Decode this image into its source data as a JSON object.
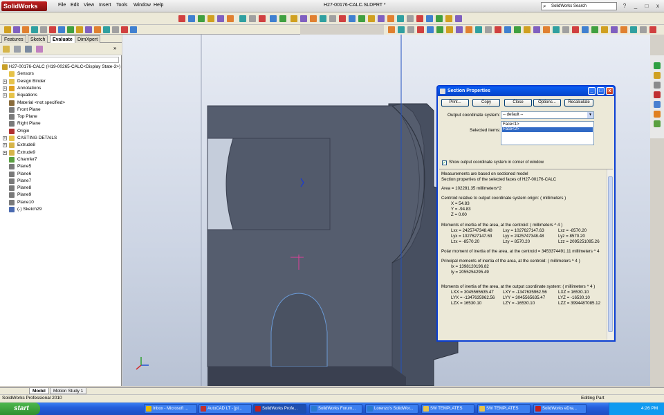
{
  "app": {
    "logo": "SolidWorks",
    "menu": [
      "File",
      "Edit",
      "View",
      "Insert",
      "Tools",
      "Window",
      "Help"
    ],
    "doc_title": "H27-00176-CALC.SLDPRT *",
    "search_placeholder": "SolidWorks Search",
    "help_icon": "?",
    "window_buttons": [
      "_",
      "□",
      "x"
    ]
  },
  "featuremanager": {
    "tabs": [
      "Features",
      "Sketch",
      "Evaluate",
      "DimXpert"
    ],
    "active_tab": "Evaluate",
    "tree": [
      {
        "label": "H27-00176-CALC (H19-00265-CALC<Display State-3>)",
        "root": true,
        "color": "#c8a028"
      },
      {
        "label": "Sensors",
        "color": "#e6c34a"
      },
      {
        "label": "Design Binder",
        "expand": "+",
        "color": "#e6c34a"
      },
      {
        "label": "Annotations",
        "expand": "+",
        "color": "#e0a020"
      },
      {
        "label": "Equations",
        "expand": "+",
        "color": "#e6c34a"
      },
      {
        "label": "Material <not specified>",
        "color": "#8a6c3c"
      },
      {
        "label": "Front Plane",
        "color": "#7a7a7a"
      },
      {
        "label": "Top Plane",
        "color": "#7a7a7a"
      },
      {
        "label": "Right Plane",
        "color": "#7a7a7a"
      },
      {
        "label": "Origin",
        "color": "#b03030"
      },
      {
        "label": "CASTING DETAILS",
        "expand": "+",
        "color": "#e6c34a"
      },
      {
        "label": "Extrude8",
        "expand": "+",
        "color": "#d6b54a"
      },
      {
        "label": "Extrude9",
        "expand": "+",
        "color": "#d6b54a"
      },
      {
        "label": "Chamfer7",
        "color": "#5aa040"
      },
      {
        "label": "Plane5",
        "color": "#7a7a7a"
      },
      {
        "label": "Plane6",
        "color": "#7a7a7a"
      },
      {
        "label": "Plane7",
        "color": "#7a7a7a"
      },
      {
        "label": "Plane8",
        "color": "#7a7a7a"
      },
      {
        "label": "Plane9",
        "color": "#7a7a7a"
      },
      {
        "label": "Plane10",
        "color": "#7a7a7a"
      },
      {
        "label": "(-) Sketch29",
        "color": "#4a6ab0"
      }
    ]
  },
  "bottom_tabs": [
    "Model",
    "Motion Study 1"
  ],
  "status": {
    "left": "SolidWorks Professional 2010",
    "editing": "Editing Part"
  },
  "dialog": {
    "title": "Section Properties",
    "buttons": [
      "Print...",
      "Copy",
      "Close",
      "Options...",
      "Recalculate"
    ],
    "coord_label": "Output coordinate system:",
    "coord_value": "-- default --",
    "selected_label": "Selected items:",
    "selected_items": [
      "Face<1>",
      "Face<2>"
    ],
    "show_cs_label": "Show output coordinate system in corner of window",
    "results": {
      "intro1": "Measurements are based on sectioned model",
      "intro2": "Section properties of the selected faces of H27-00176-CALC",
      "area": "Area = 102281.35 millimeters^2",
      "centroid_hdr": "Centroid relative to output coordinate system origin: ( millimeters )",
      "cx": "X = 54.83",
      "cy": "Y = -94.83",
      "cz": "Z = 0.00",
      "moi_hdr": "Moments of inertia of the area, at the centroid: ( millimeters ^ 4 )",
      "moi_rows": [
        [
          "Lxx = 2425747348.48",
          "Lxy = 1027627147.63",
          "Lxz = -8570.20"
        ],
        [
          "Lyx = 1027627147.63",
          "Lyy = 2425747348.48",
          "Lyz = 8570.20"
        ],
        [
          "Lzx = -8570.20",
          "Lzy = 8570.20",
          "Lzz = 2095251095.26"
        ]
      ],
      "polar": "Polar moment of inertia of the area, at the centroid = 3453374491.11 millimeters ^ 4",
      "principal_hdr": "Principal moments of inertia of the area, at the centroid: ( millimeters ^ 4 )",
      "ix": "Ix = 1398120196.82",
      "iy": "Iy = 2055254295.49",
      "out_hdr": "Moments of inertia of the area, at the output coordinate system: ( millimeters ^ 4 )",
      "out_rows": [
        [
          "LXX = 3045565635.47",
          "LXY = -1347635962.56",
          "LXZ = 16530.10"
        ],
        [
          "LYX = -1347635962.56",
          "LYY = 3045565635.47",
          "LYZ = -16530.10"
        ],
        [
          "LZX = 16530.10",
          "LZY = -16530.10",
          "LZZ = 3994487085.12"
        ]
      ]
    }
  },
  "taskbar": {
    "start": "start",
    "tasks": [
      {
        "label": "Inbox - Microsoft ...",
        "color": "#e6b800"
      },
      {
        "label": "AutoCAD LT - [pl...",
        "color": "#c03030"
      },
      {
        "label": "SolidWorks Profe...",
        "color": "#c02020",
        "active": true
      },
      {
        "label": "SolidWorks Forum...",
        "color": "#2a7ad0"
      },
      {
        "label": "Lorenzo's SolidWor...",
        "color": "#2a7ad0"
      },
      {
        "label": "SW TEMPLATES",
        "color": "#e6c34a"
      },
      {
        "label": "SW TEMPLATES",
        "color": "#e6c34a"
      },
      {
        "label": "SolidWorks eDra...",
        "color": "#c02020"
      }
    ],
    "clock": "4:26 PM"
  },
  "colors": {
    "part": "#555d6e",
    "part_edge": "#3a4050",
    "accent": "#0a3ed2"
  }
}
